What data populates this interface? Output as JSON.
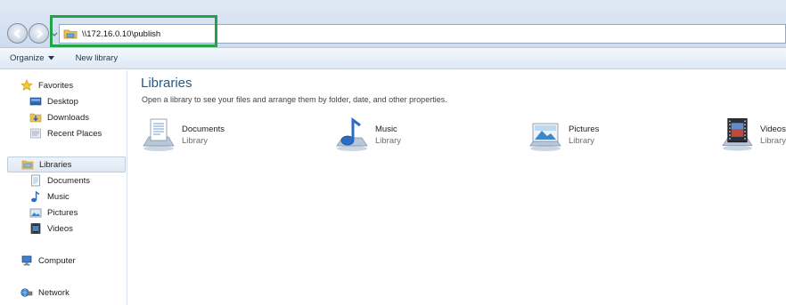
{
  "address_bar": {
    "path": "\\\\172.16.0.10\\publish"
  },
  "command_bar": {
    "organize_label": "Organize",
    "new_library_label": "New library"
  },
  "sidebar": {
    "favorites_label": "Favorites",
    "favorites_items": [
      {
        "label": "Desktop",
        "icon": "desktop-icon"
      },
      {
        "label": "Downloads",
        "icon": "downloads-icon"
      },
      {
        "label": "Recent Places",
        "icon": "recent-places-icon"
      }
    ],
    "libraries_label": "Libraries",
    "libraries_items": [
      {
        "label": "Documents",
        "icon": "documents-icon"
      },
      {
        "label": "Music",
        "icon": "music-icon"
      },
      {
        "label": "Pictures",
        "icon": "pictures-icon"
      },
      {
        "label": "Videos",
        "icon": "videos-icon"
      }
    ],
    "computer_label": "Computer",
    "network_label": "Network"
  },
  "main": {
    "title": "Libraries",
    "subtitle": "Open a library to see your files and arrange them by folder, date, and other properties.",
    "libraries": [
      {
        "name": "Documents",
        "type": "Library",
        "icon": "documents-library-icon"
      },
      {
        "name": "Music",
        "type": "Library",
        "icon": "music-library-icon"
      },
      {
        "name": "Pictures",
        "type": "Library",
        "icon": "pictures-library-icon"
      },
      {
        "name": "Videos",
        "type": "Library",
        "icon": "videos-library-icon"
      }
    ]
  },
  "colors": {
    "highlight_box": "#22a347",
    "title_blue": "#1e5a8c"
  }
}
